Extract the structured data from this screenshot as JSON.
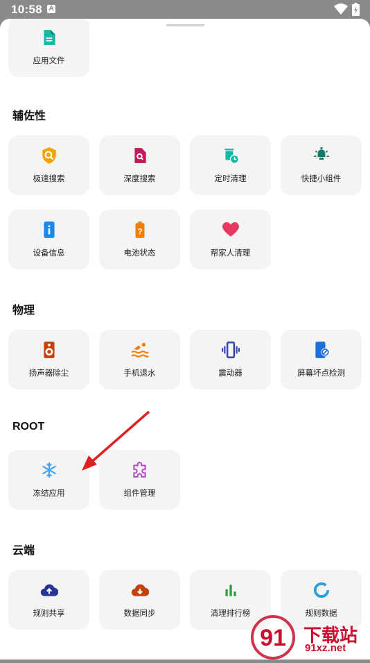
{
  "status": {
    "time": "10:58",
    "badge": "A"
  },
  "sections": {
    "top": {
      "items": [
        {
          "label": "应用文件",
          "icon": "file-icon",
          "color": "#16b8a6"
        }
      ]
    },
    "accessibility": {
      "title": "辅佐性",
      "items": [
        {
          "label": "极速搜索",
          "icon": "shield-search-icon",
          "color": "#f5a300"
        },
        {
          "label": "深度搜索",
          "icon": "file-search-icon",
          "color": "#c2185b"
        },
        {
          "label": "定时清理",
          "icon": "timed-trash-icon",
          "color": "#16b8a6"
        },
        {
          "label": "快捷小组件",
          "icon": "lightbulb-icon",
          "color": "#137a63"
        },
        {
          "label": "设备信息",
          "icon": "info-icon",
          "color": "#1e88e5"
        },
        {
          "label": "电池状态",
          "icon": "battery-icon",
          "color": "#f57c00"
        },
        {
          "label": "帮家人清理",
          "icon": "heart-icon",
          "color": "#e53960"
        }
      ]
    },
    "physics": {
      "title": "物理",
      "items": [
        {
          "label": "扬声器除尘",
          "icon": "speaker-icon",
          "color": "#c2410c"
        },
        {
          "label": "手机退水",
          "icon": "swimmer-icon",
          "color": "#f57c00"
        },
        {
          "label": "震动器",
          "icon": "vibration-icon",
          "color": "#3949ab"
        },
        {
          "label": "屏幕坏点检测",
          "icon": "phone-block-icon",
          "color": "#1e6fd9"
        }
      ]
    },
    "root": {
      "title": "ROOT",
      "items": [
        {
          "label": "冻结应用",
          "icon": "snowflake-icon",
          "color": "#42a5f5"
        },
        {
          "label": "组件管理",
          "icon": "puzzle-icon",
          "color": "#ab47bc"
        }
      ]
    },
    "cloud": {
      "title": "云端",
      "items": [
        {
          "label": "规则共享",
          "icon": "cloud-upload-icon",
          "color": "#283593"
        },
        {
          "label": "数据同步",
          "icon": "cloud-download-icon",
          "color": "#c2410c"
        },
        {
          "label": "清理排行榜",
          "icon": "bar-chart-icon",
          "color": "#2e9a3a"
        },
        {
          "label": "规则数据",
          "icon": "ring-chart-icon",
          "color": "#29a0d8"
        }
      ]
    }
  },
  "watermark": {
    "brand": "下载站",
    "url": "91xz.net",
    "logo": "91"
  }
}
